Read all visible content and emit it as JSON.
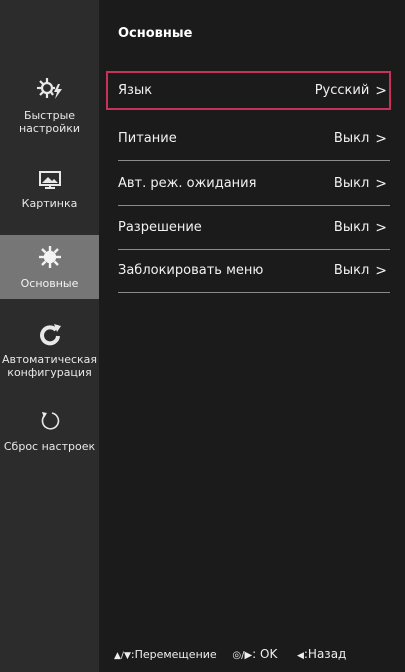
{
  "page_title": "Основные",
  "sidebar": {
    "items": [
      {
        "label": "Быстрые настройки",
        "icon": "quick-settings-icon",
        "active": false
      },
      {
        "label": "Картинка",
        "icon": "picture-icon",
        "active": false
      },
      {
        "label": "Основные",
        "icon": "gear-icon",
        "active": true
      },
      {
        "label": "Автоматическая конфигурация",
        "icon": "auto-config-icon",
        "active": false
      },
      {
        "label": "Сброс настроек",
        "icon": "reset-icon",
        "active": false
      }
    ]
  },
  "menu": {
    "items": [
      {
        "label": "Язык",
        "value": "Русский",
        "selected": true
      },
      {
        "label": "Питание",
        "value": "Выкл",
        "selected": false
      },
      {
        "label": "Авт. реж. ожидания",
        "value": "Выкл",
        "selected": false
      },
      {
        "label": "Разрешение",
        "value": "Выкл",
        "selected": false
      },
      {
        "label": "Заблокировать меню",
        "value": "Выкл",
        "selected": false
      }
    ],
    "chevron": ">"
  },
  "footer": {
    "move_keys": "▲/▼",
    "move_label": ":Перемещение",
    "ok_keys": "◎/▶",
    "ok_label": ": OK",
    "back_key": "◀",
    "back_label": ":Назад"
  },
  "colors": {
    "background": "#1b1b1b",
    "sidebar": "#2c2c2c",
    "active_item": "#767676",
    "selection_border": "#c8325a"
  }
}
